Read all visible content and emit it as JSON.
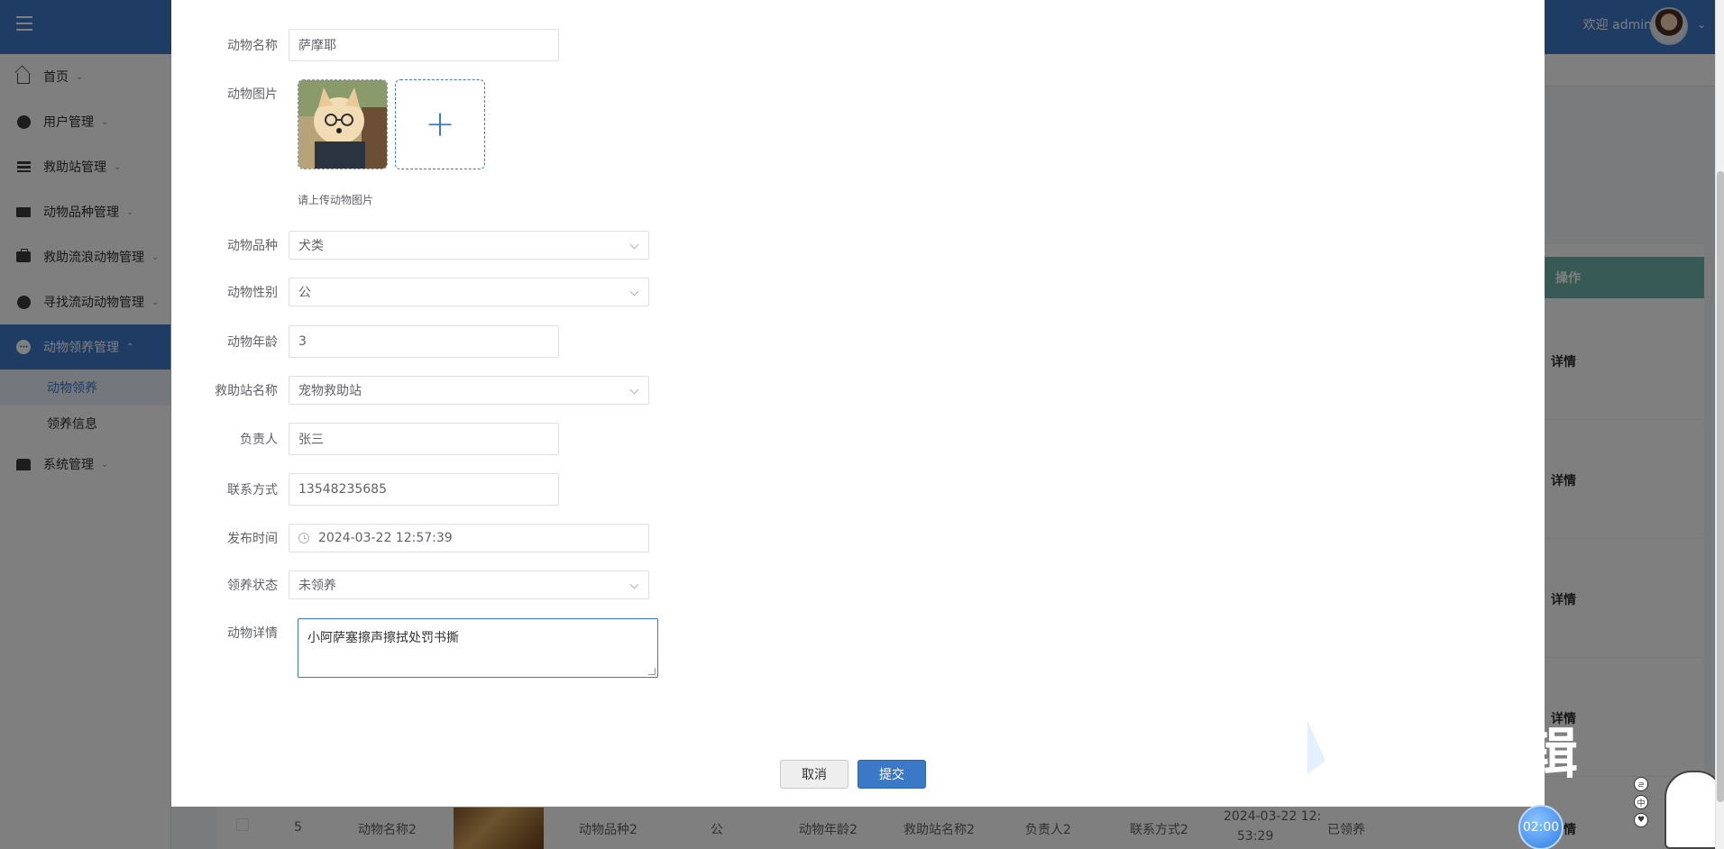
{
  "header": {
    "welcome_text": "欢迎 admin",
    "brand_color": "#3c78c8"
  },
  "sidebar": {
    "items": [
      {
        "label": "首页",
        "icon": "home-icon"
      },
      {
        "label": "用户管理",
        "icon": "gauge-icon"
      },
      {
        "label": "救助站管理",
        "icon": "list-icon"
      },
      {
        "label": "动物品种管理",
        "icon": "tv-icon"
      },
      {
        "label": "救助流浪动物管理",
        "icon": "briefcase-icon"
      },
      {
        "label": "寻找流动动物管理",
        "icon": "gauge-icon"
      },
      {
        "label": "动物领养管理",
        "icon": "more-icon",
        "active": true
      },
      {
        "label": "系统管理",
        "icon": "store-icon"
      }
    ],
    "subitems": [
      {
        "label": "动物领养",
        "active": true
      },
      {
        "label": "领养信息"
      }
    ]
  },
  "background_table": {
    "op_header": "操作",
    "detail_link": "详情",
    "bottom_row": {
      "index": "5",
      "name": "动物名称2",
      "breed": "动物品种2",
      "gender": "公",
      "age": "动物年龄2",
      "station": "救助站名称2",
      "owner": "负责人2",
      "contact": "联系方式2",
      "time": "2024-03-22 12:",
      "time2": "53:29",
      "status": "已领养",
      "detail": "详情"
    }
  },
  "form": {
    "name": {
      "label": "动物名称",
      "value": "萨摩耶"
    },
    "picture": {
      "label": "动物图片",
      "hint": "请上传动物图片"
    },
    "breed": {
      "label": "动物品种",
      "value": "犬类"
    },
    "gender": {
      "label": "动物性别",
      "value": "公"
    },
    "age": {
      "label": "动物年龄",
      "value": "3"
    },
    "station": {
      "label": "救助站名称",
      "value": "宠物救助站"
    },
    "owner": {
      "label": "负责人",
      "value": "张三"
    },
    "contact": {
      "label": "联系方式",
      "value": "13548235685"
    },
    "publish_time": {
      "label": "发布时间",
      "value": "2024-03-22 12:57:39"
    },
    "status": {
      "label": "领养状态",
      "value": "未领养"
    },
    "detail": {
      "label": "动物详情",
      "value": "小阿萨塞擦声擦拭处罚书撕"
    }
  },
  "buttons": {
    "cancel": "取消",
    "submit": "提交"
  },
  "overlay": {
    "watermark_text": "辑",
    "timer": "02:00",
    "bubbles": [
      "ㄹ",
      "中",
      "♥"
    ]
  }
}
